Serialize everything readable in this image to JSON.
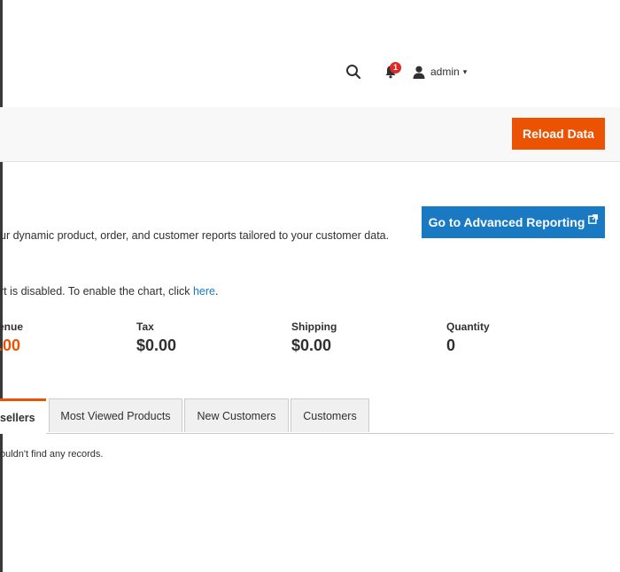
{
  "header": {
    "search_icon": "search-icon",
    "notifications": {
      "icon": "bell-icon",
      "count": "1"
    },
    "user": {
      "icon": "user-icon",
      "name": "admin",
      "caret": "▾"
    }
  },
  "toolbar": {
    "reload_label": "Reload Data"
  },
  "advanced_reporting": {
    "description": "ur dynamic product, order, and customer reports tailored to your customer data.",
    "button_label": "Go to Advanced Reporting",
    "external_icon": "external-link-icon"
  },
  "chart_notice": {
    "text": "rt is disabled. To enable the chart, click ",
    "link": "here",
    "suffix": "."
  },
  "stats": [
    {
      "label": "enue",
      "value": ".00"
    },
    {
      "label": "Tax",
      "value": "$0.00"
    },
    {
      "label": "Shipping",
      "value": "$0.00"
    },
    {
      "label": "Quantity",
      "value": "0"
    }
  ],
  "tabs": [
    {
      "label": "sellers",
      "active": true
    },
    {
      "label": "Most Viewed Products",
      "active": false
    },
    {
      "label": "New Customers",
      "active": false
    },
    {
      "label": "Customers",
      "active": false
    }
  ],
  "grid": {
    "empty_message": "ouldn't find any records."
  },
  "colors": {
    "accent": "#eb5202",
    "primary_button": "#1979c3",
    "badge": "#e22626",
    "toolbar_bg": "#f8f8f8"
  }
}
